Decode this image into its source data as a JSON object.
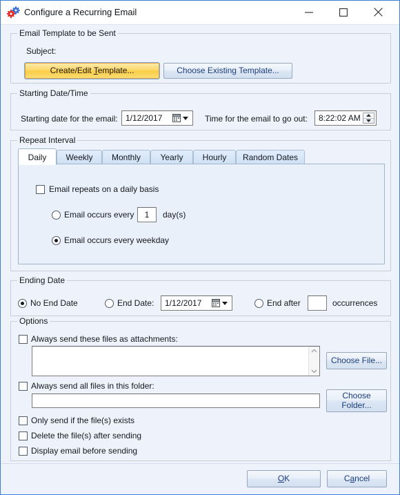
{
  "window": {
    "title": "Configure a Recurring Email",
    "icon": "gears-icon",
    "controls": {
      "minimize": "minimize-icon",
      "maximize": "maximize-icon",
      "close": "close-icon"
    }
  },
  "template_group": {
    "legend": "Email Template to be Sent",
    "subject_label": "Subject:",
    "create_edit_button": "Create/Edit Template...",
    "create_edit_mnemonic": "T",
    "choose_existing_button": "Choose Existing Template..."
  },
  "starting_group": {
    "legend": "Starting Date/Time",
    "date_label": "Starting date for the email:",
    "date_value": "1/12/2017",
    "time_label": "Time for the email to go out:",
    "time_value": "8:22:02 AM"
  },
  "repeat_group": {
    "legend": "Repeat Interval",
    "tabs": [
      {
        "label": "Daily",
        "selected": true
      },
      {
        "label": "Weekly",
        "selected": false
      },
      {
        "label": "Monthly",
        "selected": false
      },
      {
        "label": "Yearly",
        "selected": false
      },
      {
        "label": "Hourly",
        "selected": false
      },
      {
        "label": "Random Dates",
        "selected": false
      }
    ],
    "daily": {
      "repeats_checkbox_label": "Email repeats on a daily basis",
      "repeats_checked": false,
      "every_radio_label": "Email occurs every",
      "every_radio_selected": false,
      "every_value": "1",
      "every_units_label": "day(s)",
      "weekday_radio_label": "Email occurs every weekday",
      "weekday_radio_selected": true
    }
  },
  "ending_group": {
    "legend": "Ending Date",
    "no_end_label": "No End Date",
    "no_end_selected": true,
    "end_date_label": "End Date:",
    "end_date_selected": false,
    "end_date_value": "1/12/2017",
    "end_after_label": "End after",
    "end_after_selected": false,
    "end_after_value": "",
    "occurrences_label": "occurrences"
  },
  "options_group": {
    "legend": "Options",
    "attachments_checkbox_label": "Always send these files as attachments:",
    "attachments_checked": false,
    "attachments_value": "",
    "choose_file_button": "Choose File...",
    "folder_checkbox_label": "Always send all files in this folder:",
    "folder_checked": false,
    "folder_value": "",
    "choose_folder_button_line1": "Choose",
    "choose_folder_button_line2": "Folder...",
    "only_send_if_exists_label": "Only send if the file(s) exists",
    "only_send_if_exists_checked": false,
    "delete_after_sending_label": "Delete the file(s) after sending",
    "delete_after_sending_checked": false,
    "display_before_sending_label": "Display email before sending",
    "display_before_sending_checked": false
  },
  "footer": {
    "ok_button": "OK",
    "ok_mnemonic": "O",
    "cancel_button": "Cancel",
    "cancel_mnemonic": "a"
  },
  "colors": {
    "window_border": "#3a7fd5",
    "dialog_background": "#eef2fa",
    "highlight_button": "#f9cd45",
    "button_text": "#1a3c7a"
  }
}
